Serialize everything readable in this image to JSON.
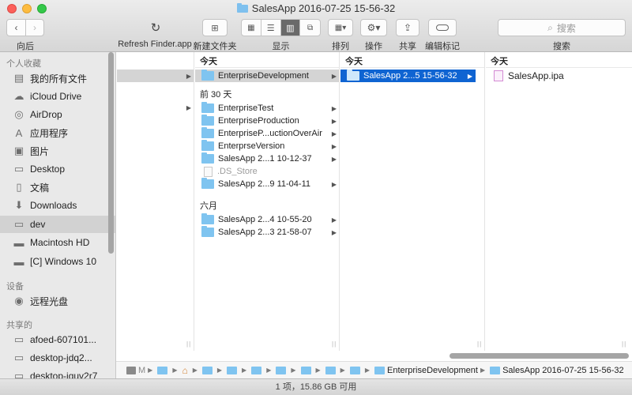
{
  "window": {
    "title": "SalesApp 2016-07-25 15-56-32"
  },
  "toolbar": {
    "back_label": "向后",
    "refresh_label": "Refresh Finder.app",
    "new_folder_label": "新建文件夹",
    "view_label": "显示",
    "arrange_label": "排列",
    "action_label": "操作",
    "share_label": "共享",
    "tags_label": "编辑标记",
    "search_placeholder": "搜索",
    "search_label": "搜索"
  },
  "sidebar": {
    "favorites_header": "个人收藏",
    "favorites": [
      {
        "label": "我的所有文件",
        "icon": "all-files-icon"
      },
      {
        "label": "iCloud Drive",
        "icon": "cloud-icon"
      },
      {
        "label": "AirDrop",
        "icon": "airdrop-icon"
      },
      {
        "label": "应用程序",
        "icon": "applications-icon"
      },
      {
        "label": "图片",
        "icon": "camera-icon"
      },
      {
        "label": "Desktop",
        "icon": "desktop-icon"
      },
      {
        "label": "文稿",
        "icon": "documents-icon"
      },
      {
        "label": "Downloads",
        "icon": "downloads-icon"
      },
      {
        "label": "dev",
        "icon": "folder-icon",
        "selected": true
      },
      {
        "label": "Macintosh HD",
        "icon": "hard-drive-icon"
      },
      {
        "label": "[C] Windows 10",
        "icon": "hard-drive-icon"
      }
    ],
    "devices_header": "设备",
    "devices": [
      {
        "label": "远程光盘",
        "icon": "disc-icon"
      }
    ],
    "shared_header": "共享的",
    "shared": [
      {
        "label": "afoed-607101...",
        "icon": "computer-icon"
      },
      {
        "label": "desktop-jdq2...",
        "icon": "computer-icon"
      },
      {
        "label": "desktop-iquv2r7",
        "icon": "computer-icon"
      }
    ]
  },
  "columns": {
    "col2": {
      "today_header": "今天",
      "today": [
        {
          "label": "EnterpriseDevelopment",
          "selected": true
        }
      ],
      "past30_header": "前 30 天",
      "past30": [
        {
          "label": "EnterpriseTest",
          "kind": "folder"
        },
        {
          "label": "EnterpriseProduction",
          "kind": "folder"
        },
        {
          "label": "EnterpriseP...uctionOverAir",
          "kind": "folder"
        },
        {
          "label": "EnterprseVersion",
          "kind": "folder"
        },
        {
          "label": "SalesApp 2...1 10-12-37",
          "kind": "folder"
        },
        {
          "label": ".DS_Store",
          "kind": "file"
        },
        {
          "label": "SalesApp 2...9 11-04-11",
          "kind": "folder"
        }
      ],
      "june_header": "六月",
      "june": [
        {
          "label": "SalesApp 2...4 10-55-20",
          "kind": "folder"
        },
        {
          "label": "SalesApp 2...3 21-58-07",
          "kind": "folder"
        }
      ]
    },
    "col3": {
      "today_header": "今天",
      "items": [
        {
          "label": "SalesApp 2...5 15-56-32",
          "selected": true
        }
      ]
    },
    "col4": {
      "today_header": "今天",
      "items": [
        {
          "label": "SalesApp.ipa"
        }
      ]
    }
  },
  "pathbar": {
    "disk_label": "M",
    "enterprise": "EnterpriseDevelopment",
    "current": "SalesApp 2016-07-25 15-56-32"
  },
  "statusbar": {
    "text": "1 项，15.86 GB 可用"
  },
  "colors": {
    "selection": "#0f64d2",
    "folder": "#7fc4f0"
  }
}
